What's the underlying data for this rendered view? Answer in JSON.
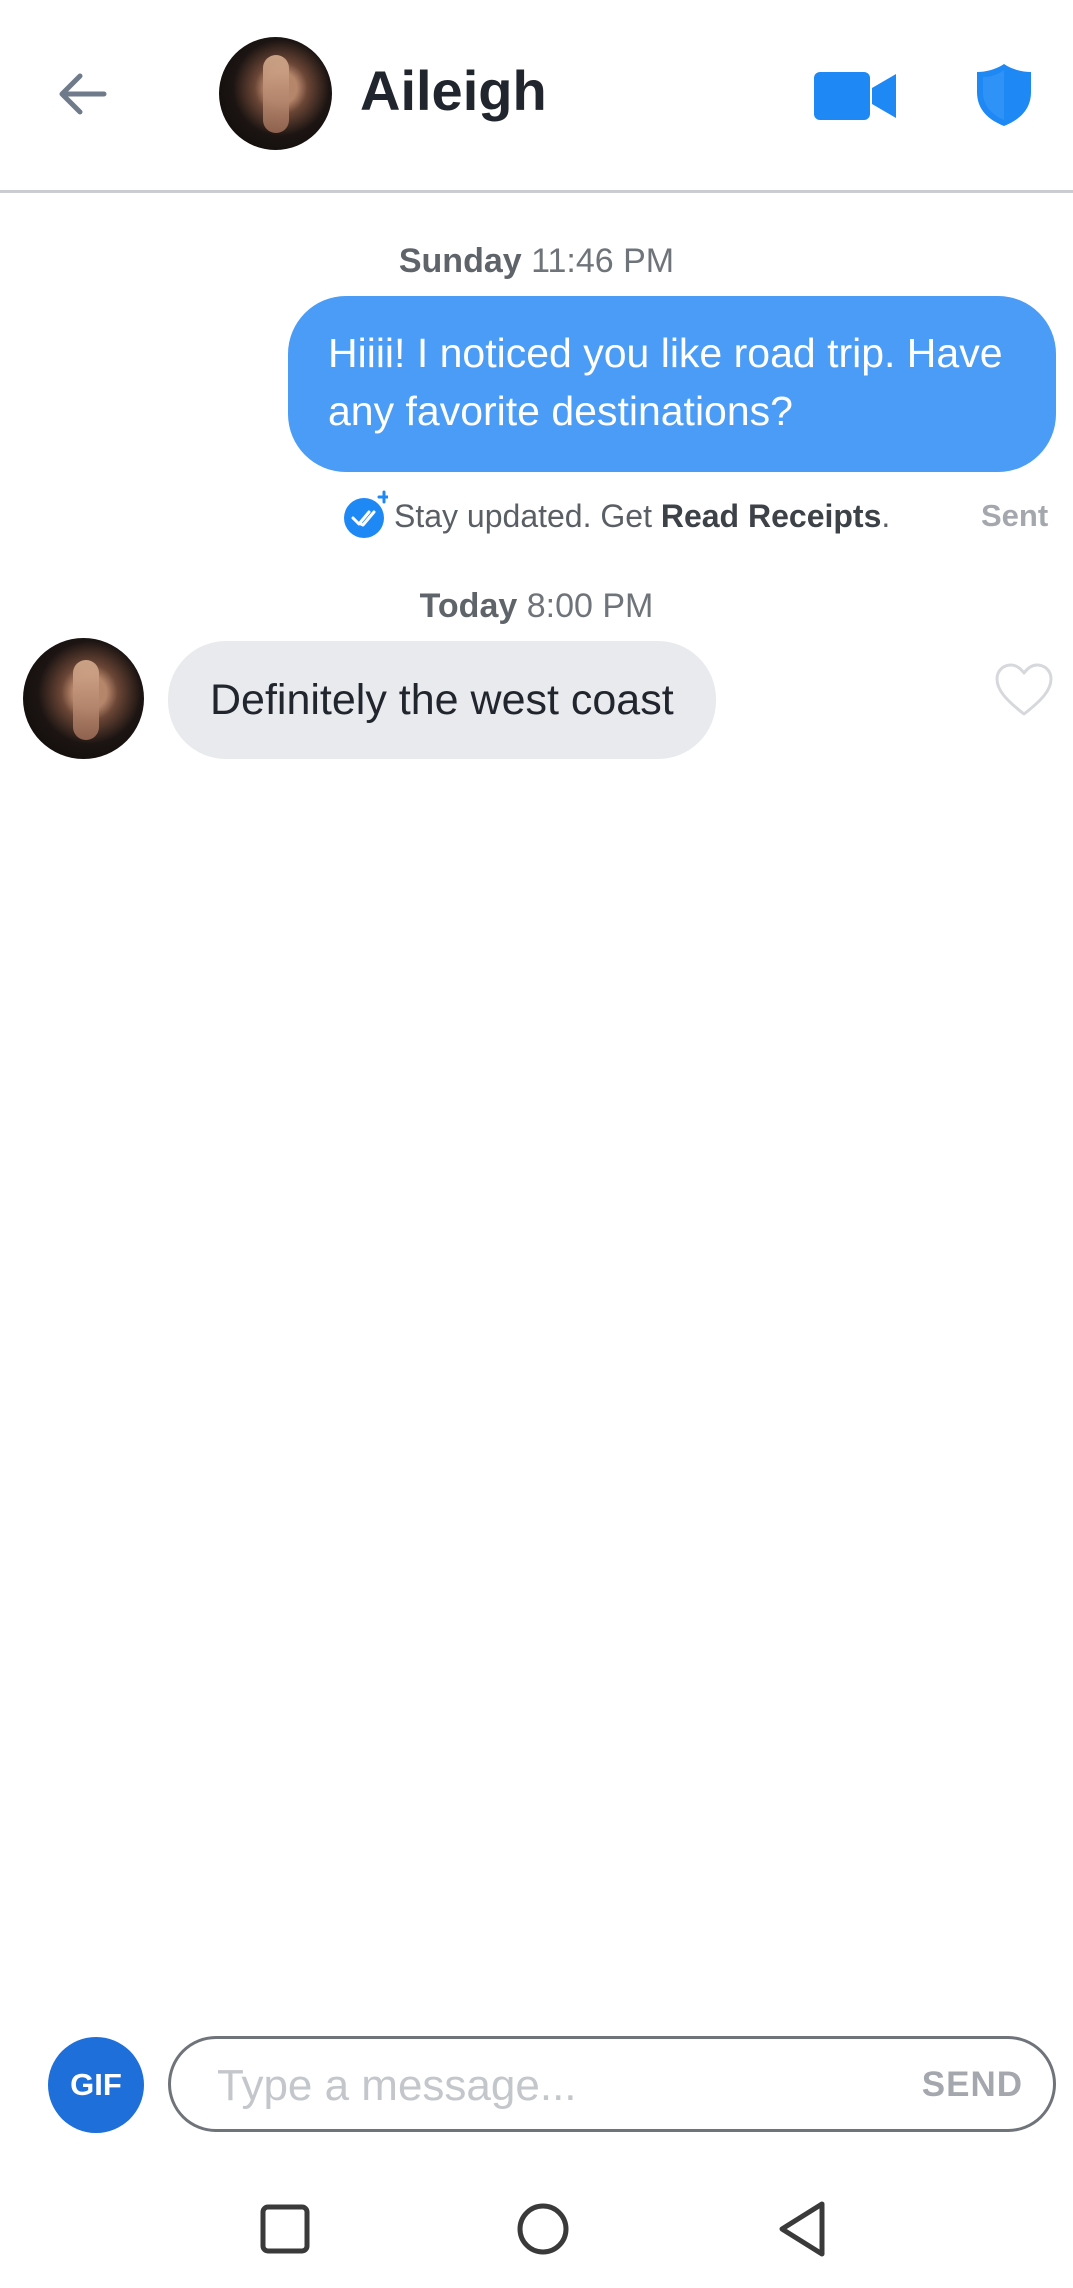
{
  "header": {
    "contact_name": "Aileigh",
    "icons": [
      "back-arrow-icon",
      "video-call-icon",
      "safety-shield-icon"
    ],
    "accent_color": "#1e88f5"
  },
  "messages": [
    {
      "day": "Sunday",
      "time": "11:46 PM",
      "direction": "outgoing",
      "text": "Hiiii! I noticed you like road trip. Have any favorite destinations?",
      "receipt_prefix": "Stay updated. Get ",
      "receipt_link": "Read Receipts",
      "receipt_suffix": ".",
      "status": "Sent"
    },
    {
      "day": "Today",
      "time": "8:00 PM",
      "direction": "incoming",
      "text": "Definitely the west coast"
    }
  ],
  "composer": {
    "gif_label": "GIF",
    "placeholder": "Type a message...",
    "send_label": "SEND"
  },
  "nav": {
    "icons": [
      "recents-square-icon",
      "home-circle-icon",
      "back-triangle-icon"
    ]
  }
}
